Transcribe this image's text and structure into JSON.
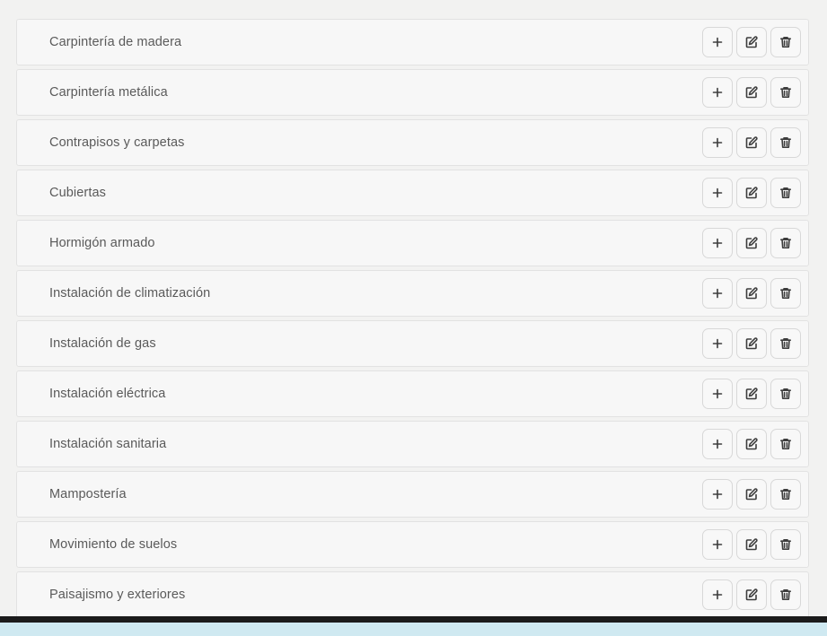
{
  "items": [
    {
      "label": "Carpintería de madera"
    },
    {
      "label": "Carpintería metálica"
    },
    {
      "label": "Contrapisos y carpetas"
    },
    {
      "label": "Cubiertas"
    },
    {
      "label": "Hormigón armado"
    },
    {
      "label": "Instalación de climatización"
    },
    {
      "label": "Instalación de gas"
    },
    {
      "label": "Instalación eléctrica"
    },
    {
      "label": "Instalación sanitaria"
    },
    {
      "label": "Mampostería"
    },
    {
      "label": "Movimiento de suelos"
    },
    {
      "label": "Paisajismo y exteriores"
    }
  ],
  "icons": {
    "add": "plus-icon",
    "edit": "edit-icon",
    "delete": "trash-icon"
  },
  "colors": {
    "background": "#f2f2f1",
    "row_background": "#f7f7f7",
    "text": "#5a5a5a",
    "bottom_bar": "#1b1b1b",
    "bottom_area": "#cfe9f1"
  }
}
